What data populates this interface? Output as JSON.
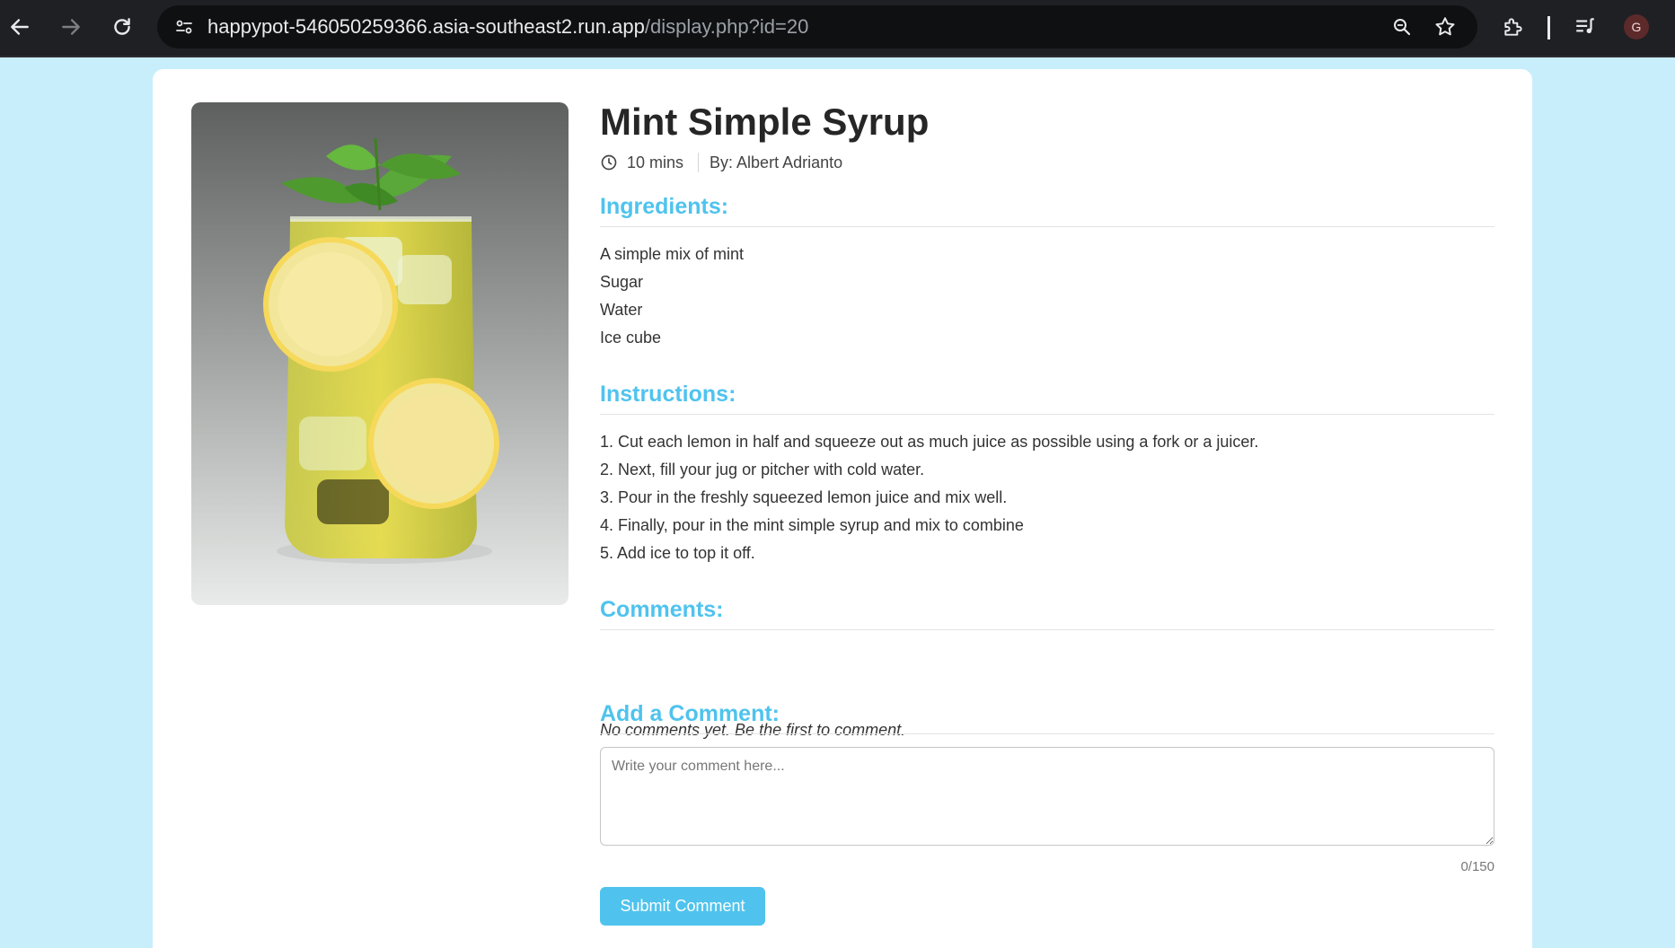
{
  "browser": {
    "url_host": "happypot-546050259366.asia-southeast2.run.app",
    "url_path": "/display.php?id=20",
    "profile_initial": "G",
    "icons": [
      "back-icon",
      "forward-icon",
      "reload-icon",
      "site-info-icon",
      "zoom-icon",
      "bookmark-star-icon",
      "extensions-icon",
      "media-controls-icon"
    ]
  },
  "recipe": {
    "title": "Mint Simple Syrup",
    "time": "10 mins",
    "author": "By: Albert Adrianto",
    "image_alt": "Glass of iced mint lemonade with lemon slices",
    "ingredients_heading": "Ingredients:",
    "ingredients": [
      "A simple mix of mint",
      "Sugar",
      "Water",
      "Ice cube"
    ],
    "instructions_heading": "Instructions:",
    "instructions": [
      "1. Cut each lemon in half and squeeze out as much juice as possible using a fork or a juicer.",
      "2. Next, fill your jug or pitcher with cold water.",
      "3. Pour in the freshly squeezed lemon juice and mix well.",
      "4. Finally, pour in the mint simple syrup and mix to combine",
      "5. Add ice to top it off."
    ]
  },
  "comments": {
    "heading": "Comments:",
    "empty_text": "No comments yet. Be the first to comment.",
    "add_heading": "Add a Comment:",
    "placeholder": "Write your comment here...",
    "char_count": "0/150",
    "submit_label": "Submit Comment"
  },
  "colors": {
    "page_background": "#c9eefb",
    "accent": "#4fc3ee",
    "heading_text": "#262626"
  }
}
